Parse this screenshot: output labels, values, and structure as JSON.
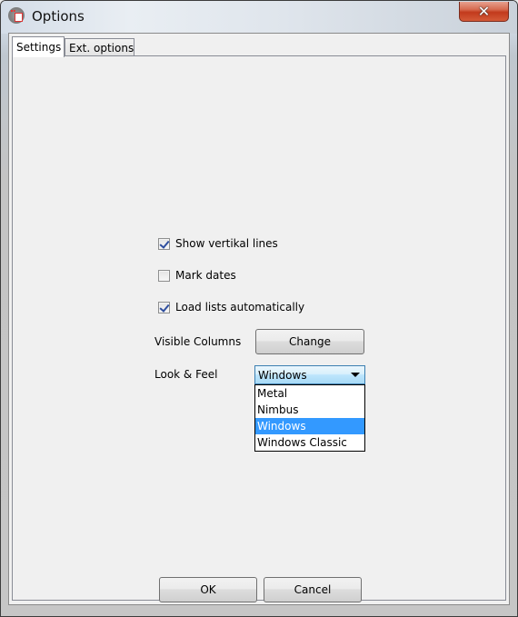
{
  "window": {
    "title": "Options",
    "app_icon": "app-icon",
    "close_glyph": "✕"
  },
  "tabs": [
    {
      "label": "Settings",
      "active": true
    },
    {
      "label": "Ext. options",
      "active": false
    }
  ],
  "settings": {
    "checkboxes": [
      {
        "label": "Show vertikal lines",
        "checked": true
      },
      {
        "label": "Mark dates",
        "checked": false
      },
      {
        "label": "Load lists automatically",
        "checked": true
      }
    ],
    "visible_columns": {
      "label": "Visible Columns",
      "button_label": "Change"
    },
    "look_and_feel": {
      "label": "Look & Feel",
      "selected": "Windows",
      "options": [
        "Metal",
        "Nimbus",
        "Windows",
        "Windows Classic"
      ],
      "highlighted_index": 2
    }
  },
  "footer": {
    "ok_label": "OK",
    "cancel_label": "Cancel"
  },
  "colors": {
    "selection": "#3399ff",
    "close_button": "#c23a1c"
  }
}
